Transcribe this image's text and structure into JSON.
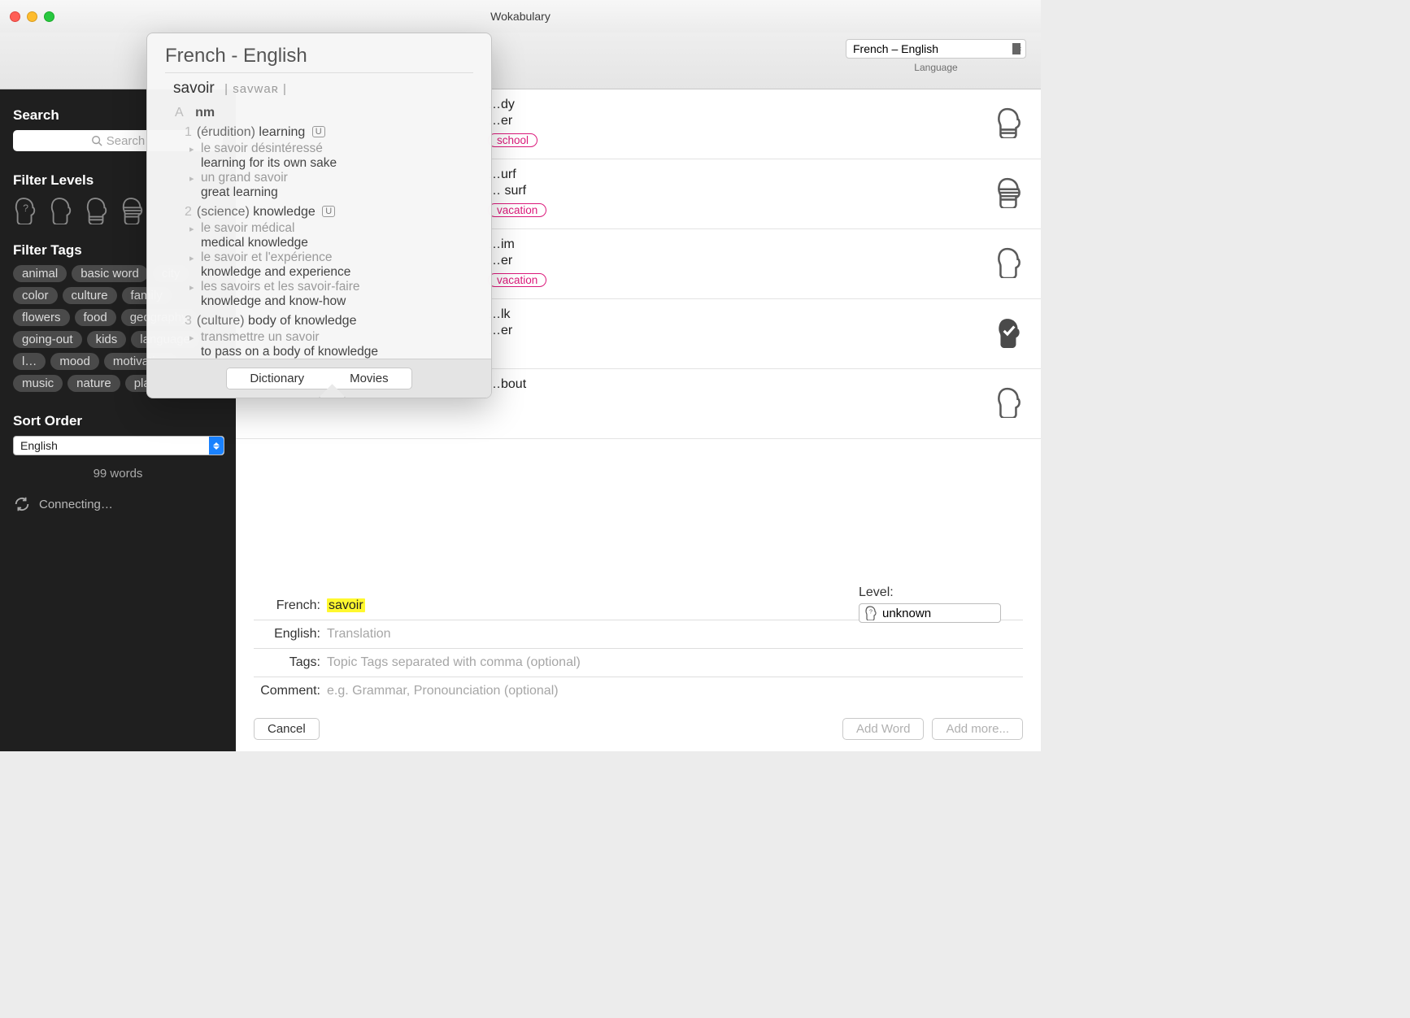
{
  "app": {
    "title": "Wokabulary"
  },
  "toolbar": {
    "language_pair": "French – English",
    "language_label": "Language"
  },
  "sidebar": {
    "search_title": "Search",
    "search_placeholder": "Search",
    "filter_levels_title": "Filter Levels",
    "filter_tags_title": "Filter Tags",
    "tags": [
      "animal",
      "basic word",
      "city",
      "color",
      "culture",
      "family",
      "flowers",
      "food",
      "geography",
      "going-out",
      "kids",
      "language",
      "l…",
      "mood",
      "motivation",
      "music",
      "nature",
      "playing"
    ],
    "sort_title": "Sort Order",
    "sort_value": "English",
    "word_count": "99 words",
    "status": "Connecting…"
  },
  "wordlist": [
    {
      "foreign": "…dy",
      "translation": "…er",
      "tags": [
        "school"
      ],
      "level": "head-stripes-2"
    },
    {
      "foreign": "…urf",
      "translation": "… surf",
      "tags": [
        "vacation"
      ],
      "level": "head-stripes-4"
    },
    {
      "foreign": "…im",
      "translation": "…er",
      "tags": [
        "vacation"
      ],
      "level": "head-plain"
    },
    {
      "foreign": "…lk",
      "translation": "…er",
      "tags": [],
      "level": "head-check"
    },
    {
      "foreign": "…bout",
      "translation": "",
      "tags": [],
      "level": "head-plain"
    }
  ],
  "form": {
    "french_label": "French:",
    "french_value": "savoir",
    "english_label": "English:",
    "english_placeholder": "Translation",
    "tags_label": "Tags:",
    "tags_placeholder": "Topic Tags separated with comma (optional)",
    "comment_label": "Comment:",
    "comment_placeholder": "e.g. Grammar, Pronounciation (optional)",
    "level_label": "Level:",
    "level_value": "unknown",
    "cancel": "Cancel",
    "add_word": "Add Word",
    "add_more": "Add more..."
  },
  "popover": {
    "title": "French - English",
    "word": "savoir",
    "pron": "| savwaʀ |",
    "pos_marker": "A",
    "pos": "nm",
    "senses": [
      {
        "n": "1",
        "domain": "(érudition)",
        "gloss": "learning",
        "u": true,
        "ex": [
          {
            "fr": "le savoir désintéressé",
            "en": "learning for its own sake"
          },
          {
            "fr": "un grand savoir",
            "en": "great learning"
          }
        ]
      },
      {
        "n": "2",
        "domain": "(science)",
        "gloss": "knowledge",
        "u": true,
        "ex": [
          {
            "fr": "le savoir médical",
            "en": "medical knowledge"
          },
          {
            "fr": "le savoir et l'expérience",
            "en": "knowledge and experience"
          },
          {
            "fr": "les savoirs et les savoir-faire",
            "en": "knowledge and know-how"
          }
        ]
      },
      {
        "n": "3",
        "domain": "(culture)",
        "gloss": "body of knowledge",
        "u": false,
        "ex": [
          {
            "fr": "transmettre un savoir",
            "en": "to pass on a body of knowledge"
          }
        ]
      }
    ],
    "tab_dict": "Dictionary",
    "tab_movies": "Movies"
  }
}
